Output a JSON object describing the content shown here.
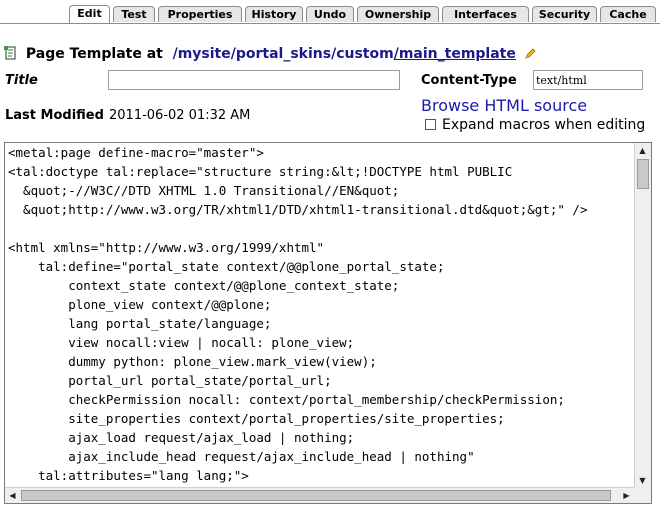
{
  "tabs": [
    {
      "label": "Edit",
      "active": true
    },
    {
      "label": "Test"
    },
    {
      "label": "Properties"
    },
    {
      "label": "History"
    },
    {
      "label": "Undo"
    },
    {
      "label": "Ownership"
    },
    {
      "label": "Interfaces"
    },
    {
      "label": "Security"
    },
    {
      "label": "Cache"
    }
  ],
  "header": {
    "prefix": "Page Template at",
    "path": [
      "/mysite",
      "/portal_skins",
      "/custom",
      "/main_template"
    ]
  },
  "form": {
    "title_label": "Title",
    "title_value": "",
    "content_type_label": "Content-Type",
    "content_type_value": "text/html",
    "last_modified_label": "Last Modified",
    "last_modified_value": "2011-06-02 01:32 AM",
    "browse_link": "Browse HTML source",
    "expand_macros_label": "Expand macros when editing"
  },
  "editor": {
    "lines": [
      "<metal:page define-macro=\"master\">",
      "<tal:doctype tal:replace=\"structure string:&lt;!DOCTYPE html PUBLIC",
      "  &quot;-//W3C//DTD XHTML 1.0 Transitional//EN&quot;",
      "  &quot;http://www.w3.org/TR/xhtml1/DTD/xhtml1-transitional.dtd&quot;&gt;\" />",
      "",
      "<html xmlns=\"http://www.w3.org/1999/xhtml\"",
      "    tal:define=\"portal_state context/@@plone_portal_state;",
      "        context_state context/@@plone_context_state;",
      "        plone_view context/@@plone;",
      "        lang portal_state/language;",
      "        view nocall:view | nocall: plone_view;",
      "        dummy python: plone_view.mark_view(view);",
      "        portal_url portal_state/portal_url;",
      "        checkPermission nocall: context/portal_membership/checkPermission;",
      "        site_properties context/portal_properties/site_properties;",
      "        ajax_load request/ajax_load | nothing;",
      "        ajax_include_head request/ajax_include_head | nothing\"",
      "    tal:attributes=\"lang lang;\">"
    ]
  }
}
